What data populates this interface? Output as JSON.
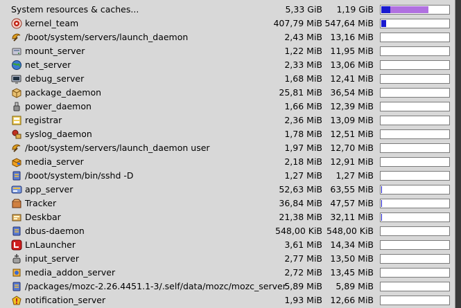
{
  "colors": {
    "bar_memory": "#1a1ad0",
    "bar_cache": "#b070e0"
  },
  "header": {
    "label": "System resources & caches...",
    "memory": "5,33 GiB",
    "swap": "1,19 GiB",
    "bar": {
      "a": 0.13,
      "b": 0.56
    }
  },
  "rows": [
    {
      "name": "kernel_team",
      "memory": "407,79 MiB",
      "swap": "547,64 MiB",
      "icon": "kernel-icon",
      "bar": {
        "a": 0.07,
        "b": 0
      }
    },
    {
      "name": "/boot/system/servers/launch_daemon",
      "memory": "2,43 MiB",
      "swap": "13,16 MiB",
      "icon": "launch-daemon-icon",
      "bar": {
        "a": 0,
        "b": 0
      }
    },
    {
      "name": "mount_server",
      "memory": "1,22 MiB",
      "swap": "11,95 MiB",
      "icon": "mount-server-icon",
      "bar": {
        "a": 0,
        "b": 0
      }
    },
    {
      "name": "net_server",
      "memory": "2,33 MiB",
      "swap": "13,06 MiB",
      "icon": "net-server-icon",
      "bar": {
        "a": 0,
        "b": 0
      }
    },
    {
      "name": "debug_server",
      "memory": "1,68 MiB",
      "swap": "12,41 MiB",
      "icon": "debug-server-icon",
      "bar": {
        "a": 0,
        "b": 0
      }
    },
    {
      "name": "package_daemon",
      "memory": "25,81 MiB",
      "swap": "36,54 MiB",
      "icon": "package-daemon-icon",
      "bar": {
        "a": 0,
        "b": 0
      }
    },
    {
      "name": "power_daemon",
      "memory": "1,66 MiB",
      "swap": "12,39 MiB",
      "icon": "power-daemon-icon",
      "bar": {
        "a": 0,
        "b": 0
      }
    },
    {
      "name": "registrar",
      "memory": "2,36 MiB",
      "swap": "13,09 MiB",
      "icon": "registrar-icon",
      "bar": {
        "a": 0,
        "b": 0
      }
    },
    {
      "name": "syslog_daemon",
      "memory": "1,78 MiB",
      "swap": "12,51 MiB",
      "icon": "syslog-daemon-icon",
      "bar": {
        "a": 0,
        "b": 0
      }
    },
    {
      "name": "/boot/system/servers/launch_daemon user",
      "memory": "1,97 MiB",
      "swap": "12,70 MiB",
      "icon": "launch-daemon-icon",
      "bar": {
        "a": 0,
        "b": 0
      }
    },
    {
      "name": "media_server",
      "memory": "2,18 MiB",
      "swap": "12,91 MiB",
      "icon": "media-server-icon",
      "bar": {
        "a": 0,
        "b": 0
      }
    },
    {
      "name": "/boot/system/bin/sshd -D",
      "memory": "1,27 MiB",
      "swap": "1,27 MiB",
      "icon": "app-icon",
      "bar": {
        "a": 0,
        "b": 0
      }
    },
    {
      "name": "app_server",
      "memory": "52,63 MiB",
      "swap": "63,55 MiB",
      "icon": "app-server-icon",
      "bar": {
        "a": 0.01,
        "b": 0
      }
    },
    {
      "name": "Tracker",
      "memory": "36,84 MiB",
      "swap": "47,57 MiB",
      "icon": "tracker-icon",
      "bar": {
        "a": 0.01,
        "b": 0
      }
    },
    {
      "name": "Deskbar",
      "memory": "21,38 MiB",
      "swap": "32,11 MiB",
      "icon": "deskbar-icon",
      "bar": {
        "a": 0.01,
        "b": 0
      }
    },
    {
      "name": "dbus-daemon",
      "memory": "548,00 KiB",
      "swap": "548,00 KiB",
      "icon": "app-icon",
      "bar": {
        "a": 0,
        "b": 0
      }
    },
    {
      "name": "LnLauncher",
      "memory": "3,61 MiB",
      "swap": "14,34 MiB",
      "icon": "lnlauncher-icon",
      "bar": {
        "a": 0,
        "b": 0
      }
    },
    {
      "name": "input_server",
      "memory": "2,77 MiB",
      "swap": "13,50 MiB",
      "icon": "input-server-icon",
      "bar": {
        "a": 0,
        "b": 0
      }
    },
    {
      "name": "media_addon_server",
      "memory": "2,72 MiB",
      "swap": "13,45 MiB",
      "icon": "media-addon-server-icon",
      "bar": {
        "a": 0,
        "b": 0
      }
    },
    {
      "name": "/packages/mozc-2.26.4451.1-3/.self/data/mozc/mozc_server",
      "memory": "5,89 MiB",
      "swap": "5,89 MiB",
      "icon": "app-icon",
      "bar": {
        "a": 0,
        "b": 0
      }
    },
    {
      "name": "notification_server",
      "memory": "1,93 MiB",
      "swap": "12,66 MiB",
      "icon": "notification-server-icon",
      "bar": {
        "a": 0,
        "b": 0
      }
    }
  ]
}
